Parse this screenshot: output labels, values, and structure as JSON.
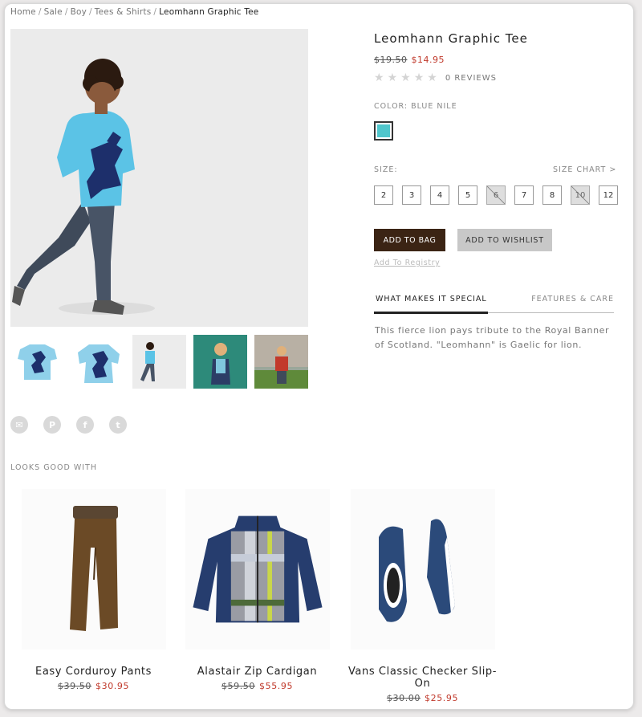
{
  "breadcrumb": {
    "items": [
      "Home",
      "Sale",
      "Boy",
      "Tees & Shirts"
    ],
    "separator": "/",
    "current": "Leomhann Graphic Tee"
  },
  "product": {
    "title": "Leomhann Graphic Tee",
    "old_price": "$19.50",
    "new_price": "$14.95",
    "rating": 0,
    "reviews": "0 REVIEWS",
    "color_label": "COLOR: BLUE NILE",
    "color_swatch": "#4fc6cc",
    "size_label": "SIZE:",
    "size_chart": "SIZE CHART >",
    "sizes": [
      {
        "label": "2",
        "available": true
      },
      {
        "label": "3",
        "available": true
      },
      {
        "label": "4",
        "available": true
      },
      {
        "label": "5",
        "available": true
      },
      {
        "label": "6",
        "available": false
      },
      {
        "label": "7",
        "available": true
      },
      {
        "label": "8",
        "available": true
      },
      {
        "label": "10",
        "available": false
      },
      {
        "label": "12",
        "available": true
      }
    ],
    "add_to_bag": "ADD TO BAG",
    "add_to_wishlist": "ADD TO WISHLIST",
    "add_to_registry": "Add To Registry",
    "tabs": {
      "active": "WHAT MAKES IT SPECIAL",
      "inactive": "FEATURES & CARE"
    },
    "description": "This fierce lion pays tribute to the Royal Banner of Scotland. \"Leomhann\" is Gaelic for lion."
  },
  "share": {
    "icons": [
      "email-icon",
      "pinterest-icon",
      "facebook-icon",
      "twitter-icon"
    ],
    "glyphs": [
      "✉",
      "P",
      "f",
      "t"
    ]
  },
  "looks_good_with": {
    "heading": "LOOKS GOOD WITH",
    "items": [
      {
        "name": "Easy Corduroy Pants",
        "old_price": "$39.50",
        "new_price": "$30.95"
      },
      {
        "name": "Alastair Zip Cardigan",
        "old_price": "$59.50",
        "new_price": "$55.95"
      },
      {
        "name": "Vans Classic Checker Slip-On",
        "old_price": "$30.00",
        "new_price": "$25.95"
      }
    ]
  },
  "colors": {
    "accent": "#3b2414",
    "sale": "#c0392b",
    "tee": "#5bc3e6"
  }
}
